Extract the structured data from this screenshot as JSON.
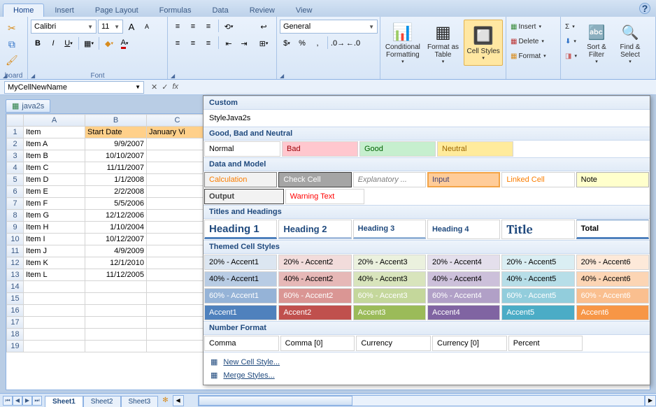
{
  "tabs": [
    "Home",
    "Insert",
    "Page Layout",
    "Formulas",
    "Data",
    "Review",
    "View"
  ],
  "active_tab": "Home",
  "groups": {
    "clipboard": "board",
    "font": "Font"
  },
  "font": {
    "name": "Calibri",
    "size": "11"
  },
  "number_format": "General",
  "style_buttons": {
    "conditional": "Conditional Formatting",
    "format_table": "Format as Table",
    "cell_styles": "Cell Styles"
  },
  "cells": {
    "insert": "Insert",
    "delete": "Delete",
    "format": "Format"
  },
  "editing": {
    "sort": "Sort & Filter",
    "find": "Find & Select"
  },
  "name_box": "MyCellNewName",
  "workbook_tab": "java2s",
  "columns": [
    "A",
    "B",
    "C"
  ],
  "headers": {
    "A": "Item",
    "B": "Start Date",
    "C": "January Vi"
  },
  "rows": [
    {
      "n": "1",
      "a": "Item",
      "b": "Start Date",
      "c": "January Vi"
    },
    {
      "n": "2",
      "a": "Item A",
      "b": "9/9/2007",
      "c": ""
    },
    {
      "n": "3",
      "a": "Item B",
      "b": "10/10/2007",
      "c": ""
    },
    {
      "n": "4",
      "a": "Item C",
      "b": "11/11/2007",
      "c": ""
    },
    {
      "n": "5",
      "a": "Item D",
      "b": "1/1/2008",
      "c": ""
    },
    {
      "n": "6",
      "a": "Item E",
      "b": "2/2/2008",
      "c": ""
    },
    {
      "n": "7",
      "a": "Item F",
      "b": "5/5/2006",
      "c": ""
    },
    {
      "n": "8",
      "a": "Item G",
      "b": "12/12/2006",
      "c": ""
    },
    {
      "n": "9",
      "a": "Item H",
      "b": "1/10/2004",
      "c": ""
    },
    {
      "n": "10",
      "a": "Item I",
      "b": "10/12/2007",
      "c": ""
    },
    {
      "n": "11",
      "a": "Item J",
      "b": "4/9/2009",
      "c": ""
    },
    {
      "n": "12",
      "a": "Item K",
      "b": "12/1/2010",
      "c": ""
    },
    {
      "n": "13",
      "a": "Item L",
      "b": "11/12/2005",
      "c": ""
    },
    {
      "n": "14",
      "a": "",
      "b": "",
      "c": ""
    },
    {
      "n": "15",
      "a": "",
      "b": "",
      "c": ""
    },
    {
      "n": "16",
      "a": "",
      "b": "",
      "c": ""
    },
    {
      "n": "17",
      "a": "",
      "b": "",
      "c": ""
    },
    {
      "n": "18",
      "a": "",
      "b": "",
      "c": ""
    },
    {
      "n": "19",
      "a": "",
      "b": "",
      "c": ""
    }
  ],
  "gallery": {
    "section_custom": "Custom",
    "custom_style": "StyleJava2s",
    "section_gbn": "Good, Bad and Neutral",
    "gbn": [
      {
        "label": "Normal",
        "bg": "#ffffff",
        "fg": "#000000"
      },
      {
        "label": "Bad",
        "bg": "#ffc7ce",
        "fg": "#9c0006"
      },
      {
        "label": "Good",
        "bg": "#c6efce",
        "fg": "#006100"
      },
      {
        "label": "Neutral",
        "bg": "#ffeb9c",
        "fg": "#9c6500"
      }
    ],
    "section_dm": "Data and Model",
    "dm": [
      {
        "label": "Calculation",
        "bg": "#f2f2f2",
        "fg": "#fa7d00",
        "bd": "#7f7f7f"
      },
      {
        "label": "Check Cell",
        "bg": "#a5a5a5",
        "fg": "#ffffff",
        "bd": "#3f3f3f"
      },
      {
        "label": "Explanatory ...",
        "bg": "#ffffff",
        "fg": "#7f7f7f",
        "it": true
      },
      {
        "label": "Input",
        "bg": "#ffcc99",
        "fg": "#3f3f76",
        "bd": "#7f7f7f",
        "hover": true
      },
      {
        "label": "Linked Cell",
        "bg": "#ffffff",
        "fg": "#fa7d00"
      },
      {
        "label": "Note",
        "bg": "#ffffcc",
        "fg": "#000000",
        "bd": "#b2b2b2"
      }
    ],
    "dm2": [
      {
        "label": "Output",
        "bg": "#f2f2f2",
        "fg": "#3f3f3f",
        "bd": "#3f3f3f",
        "bold": true
      },
      {
        "label": "Warning Text",
        "bg": "#ffffff",
        "fg": "#ff0000"
      }
    ],
    "section_th": "Titles and Headings",
    "th": [
      {
        "label": "Heading 1",
        "fg": "#1f497d",
        "fs": "15px",
        "bold": true,
        "ub": "#4f81bd"
      },
      {
        "label": "Heading 2",
        "fg": "#1f497d",
        "fs": "13px",
        "bold": true,
        "ub": "#a7bfde"
      },
      {
        "label": "Heading 3",
        "fg": "#1f497d",
        "fs": "11px",
        "bold": true,
        "ub": "#95b3d7"
      },
      {
        "label": "Heading 4",
        "fg": "#1f497d",
        "fs": "11px",
        "bold": true
      },
      {
        "label": "Title",
        "fg": "#1f497d",
        "ff": "Cambria,serif",
        "fs": "18px",
        "bold": true
      },
      {
        "label": "Total",
        "fg": "#000000",
        "fs": "11px",
        "bold": true,
        "ut": "#4f81bd",
        "ub": "#4f81bd"
      }
    ],
    "section_tc": "Themed Cell Styles",
    "accents": [
      {
        "name": "Accent1",
        "c": "#4f81bd",
        "c20": "#dce6f1",
        "c40": "#b8cce4",
        "c60": "#95b3d7"
      },
      {
        "name": "Accent2",
        "c": "#c0504d",
        "c20": "#f2dcdb",
        "c40": "#e6b8b7",
        "c60": "#da9694"
      },
      {
        "name": "Accent3",
        "c": "#9bbb59",
        "c20": "#ebf1de",
        "c40": "#d8e4bc",
        "c60": "#c4d79b"
      },
      {
        "name": "Accent4",
        "c": "#8064a2",
        "c20": "#e4dfec",
        "c40": "#ccc0da",
        "c60": "#b1a0c7"
      },
      {
        "name": "Accent5",
        "c": "#4bacc6",
        "c20": "#daeef3",
        "c40": "#b7dee8",
        "c60": "#92cddc"
      },
      {
        "name": "Accent6",
        "c": "#f79646",
        "c20": "#fde9d9",
        "c40": "#fcd5b4",
        "c60": "#fabf8f"
      }
    ],
    "accent_labels": {
      "p20": "20% - ",
      "p40": "40% - ",
      "p60": "60% - "
    },
    "section_nf": "Number Format",
    "nf": [
      "Comma",
      "Comma [0]",
      "Currency",
      "Currency [0]",
      "Percent"
    ],
    "footer": {
      "new": "New Cell Style...",
      "merge": "Merge Styles..."
    }
  },
  "sheet_tabs": [
    "Sheet1",
    "Sheet2",
    "Sheet3"
  ],
  "active_sheet": "Sheet1"
}
